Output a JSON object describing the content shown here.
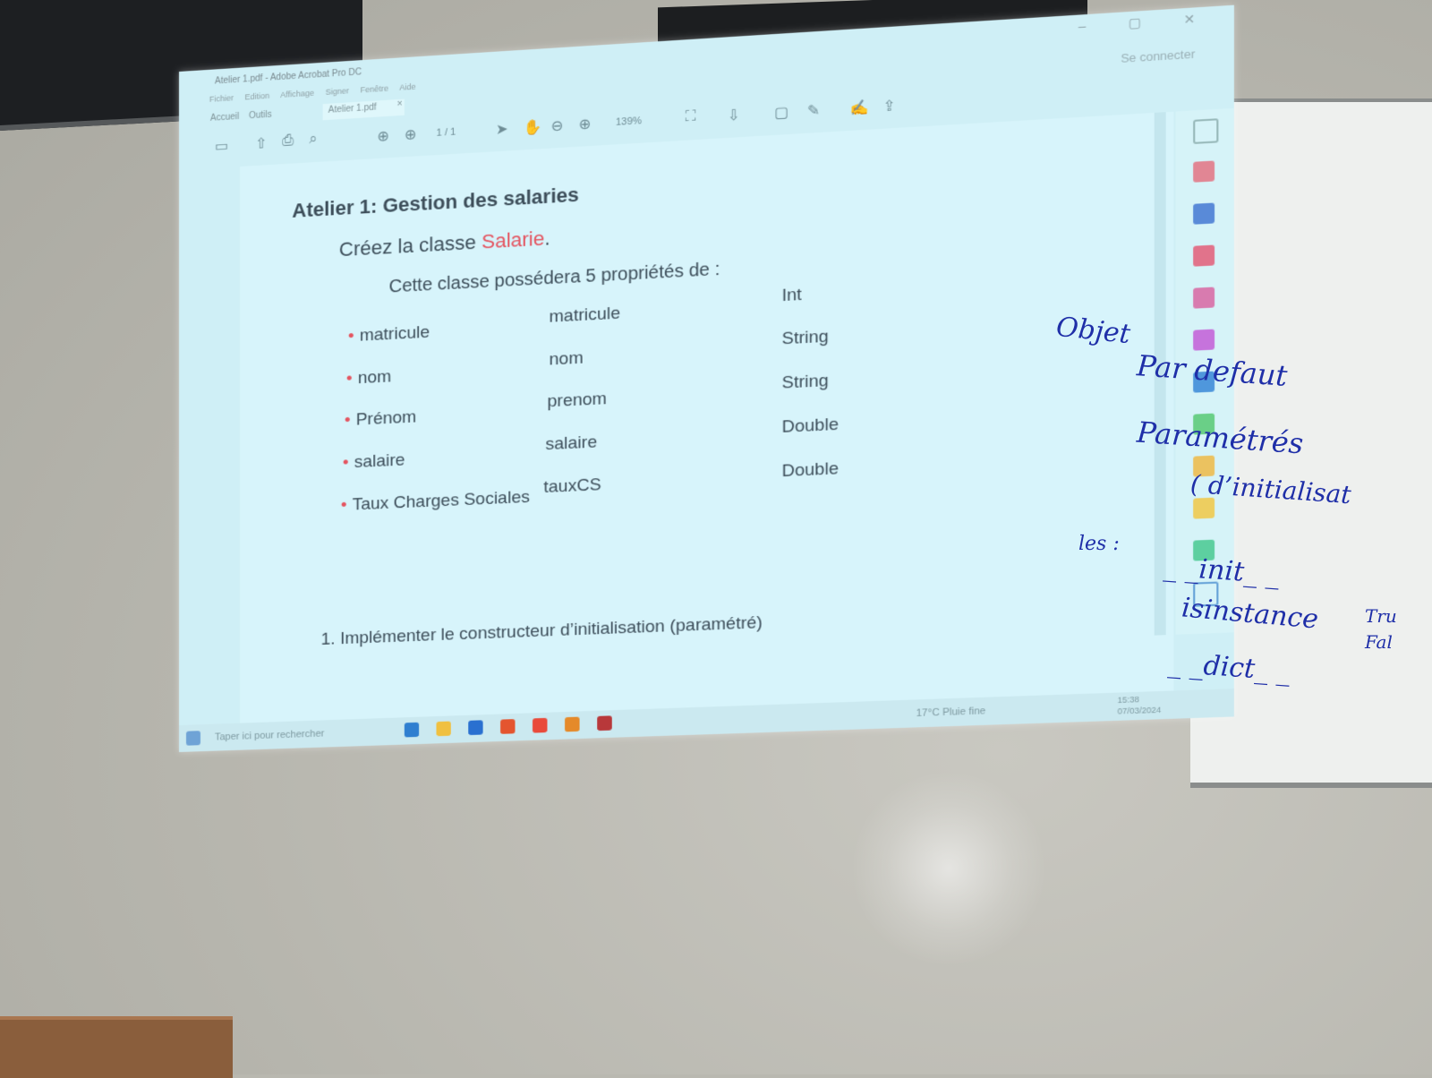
{
  "window": {
    "title": "Atelier 1.pdf - Adobe Acrobat Pro DC",
    "menu": [
      "Fichier",
      "Edition",
      "Affichage",
      "Signer",
      "Fenêtre",
      "Aide"
    ],
    "home_tab": "Accueil",
    "tools_tab": "Outils",
    "doc_tab": "Atelier 1.pdf",
    "tab_close": "×",
    "signin": "Se connecter"
  },
  "toolbar": {
    "page_indicator": "1 / 1",
    "zoom": "139%"
  },
  "document": {
    "heading": "Atelier 1: Gestion des salaries",
    "create_prefix": "Créez la classe ",
    "class_name": "Salarie",
    "create_suffix": ".",
    "description": "Cette classe possédera 5 propriétés de :",
    "properties": [
      {
        "label": "matricule",
        "name": "matricule",
        "type": "Int"
      },
      {
        "label": "nom",
        "name": "nom",
        "type": "String"
      },
      {
        "label": "Prénom",
        "name": "prenom",
        "type": "String"
      },
      {
        "label": "salaire",
        "name": "salaire",
        "type": "Double"
      },
      {
        "label": "Taux Charges Sociales",
        "name": "tauxCS",
        "type": "Double"
      }
    ],
    "task_number": "1.",
    "task_text": "Implémenter le constructeur d’initialisation (paramétré)"
  },
  "taskbar": {
    "search_placeholder": "Taper ici pour rechercher",
    "weather": "17°C  Pluie fine",
    "time": "15:38",
    "date": "07/03/2024"
  },
  "handwriting": {
    "objet": "Objet",
    "par_defaut": "Par defaut",
    "parametres": "Paramétrés",
    "initialisation": "( d’initialisat",
    "les": "les :",
    "init": "_ _init_ _",
    "isinstance": "isinstance",
    "true": "Tru",
    "false": "Fal",
    "dict": "_ _dict_ _"
  }
}
